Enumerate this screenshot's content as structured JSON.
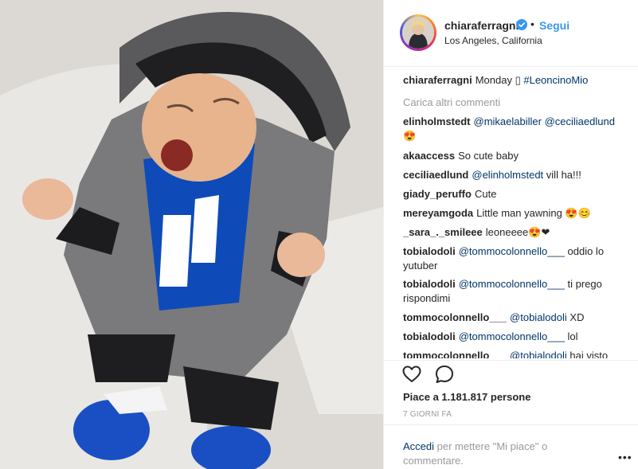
{
  "post": {
    "username": "chiaraferragni",
    "follow_label": "Segui",
    "separator": "•",
    "location": "Los Angeles, California",
    "caption_user": "chiaraferragni",
    "caption_text": "Monday",
    "caption_emoji": "▯",
    "caption_tag": "#LeoncinoMio",
    "load_more": "Carica altri commenti"
  },
  "comments": [
    {
      "user": "elinholmstedt",
      "mention": "@mikaelabiller @ceciliaedlund",
      "text": "😍"
    },
    {
      "user": "akaaccess",
      "mention": "",
      "text": "So cute baby"
    },
    {
      "user": "ceciliaedlund",
      "mention": "@elinholmstedt",
      "text": "vill ha!!!"
    },
    {
      "user": "giady_peruffo",
      "mention": "",
      "text": "Cute"
    },
    {
      "user": "mereyamgoda",
      "mention": "",
      "text": "Little man yawning 😍😊"
    },
    {
      "user": "_sara_._smileee",
      "mention": "",
      "text": "leoneeee😍❤"
    },
    {
      "user": "tobialodoli",
      "mention": "@tommocolonnello___",
      "text": "oddio lo yutuber"
    },
    {
      "user": "tobialodoli",
      "mention": "@tommocolonnello___",
      "text": "ti prego rispondimi"
    },
    {
      "user": "tommocolonnello___",
      "mention": "@tobialodoli",
      "text": "XD"
    },
    {
      "user": "tobialodoli",
      "mention": "@tommocolonnello___",
      "text": "lol"
    },
    {
      "user": "tommocolonnello___",
      "mention": "@tobialodoli",
      "text": "hai visto"
    }
  ],
  "stats": {
    "likes": "Piace a 1.181.817 persone",
    "time_ago": "7 GIORNI FA"
  },
  "footer": {
    "login_link": "Accedi",
    "login_text": " per mettere \"Mi piace\" o commentare.",
    "more": "•••"
  },
  "icons": {
    "heart": "heart-icon",
    "comment": "comment-icon",
    "verified": "verified-badge-icon",
    "more": "more-options-icon"
  },
  "colors": {
    "accent": "#3897f0",
    "mention": "#003569",
    "muted": "#999999"
  }
}
